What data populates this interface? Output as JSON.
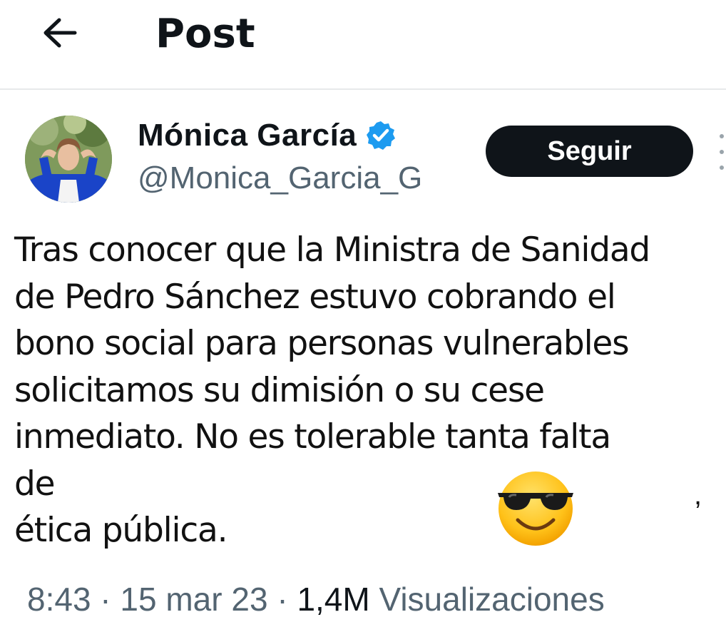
{
  "header": {
    "title": "Post",
    "back_icon": "arrow-left-icon"
  },
  "author": {
    "name": "Mónica García",
    "handle": "@Monica_Garcia_G",
    "verified_icon": "verified-badge-icon",
    "verified_color": "#1d9bf0",
    "avatar": "profile-photo"
  },
  "follow_button": {
    "label": "Seguir"
  },
  "more_icon": "more-vertical-icon",
  "tweet": {
    "text": "Tras conocer que la Ministra de Sanidad\nde Pedro Sánchez estuvo cobrando el\nbono social para personas vulnerables\nsolicitamos su dimisión o su cese\ninmediato. No es tolerable tanta falta de\nética pública.",
    "emoji_icon": "smiling-face-with-sunglasses-icon",
    "trailing_char": ","
  },
  "meta": {
    "time": "8:43",
    "date": "15 mar 23",
    "views_count": "1,4M",
    "views_label": "Visualizaciones",
    "separator": " · "
  },
  "colors": {
    "text_primary": "#0f1419",
    "text_secondary": "#536471",
    "divider": "#e7e9ea",
    "button_bg": "#0f1419"
  }
}
